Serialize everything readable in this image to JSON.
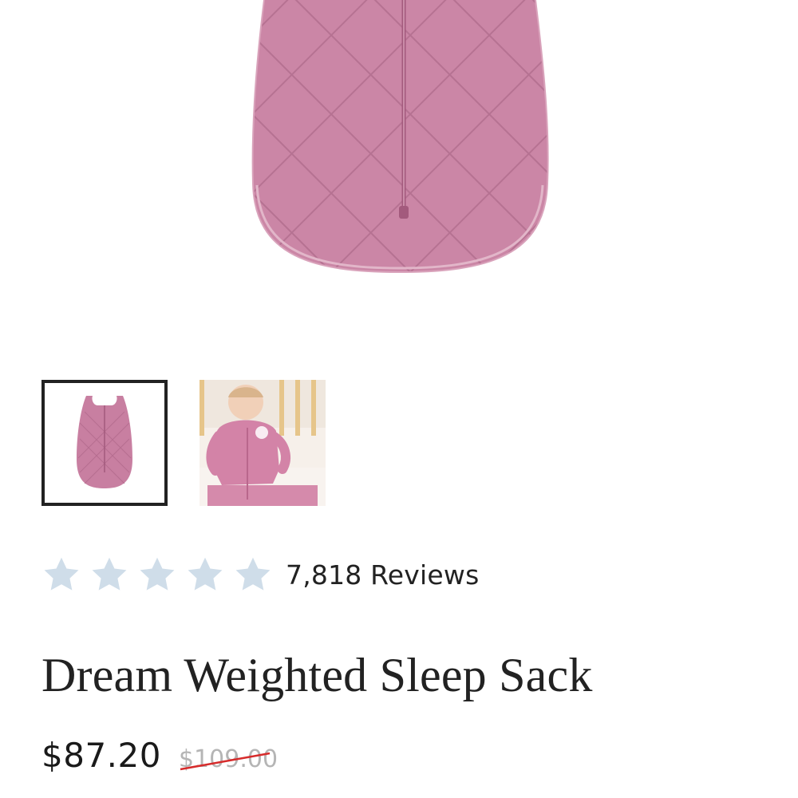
{
  "gallery": {
    "main_image": "pink-weighted-sleep-sack-product-photo",
    "thumbnails": [
      {
        "name": "sleep-sack-flat",
        "active": true
      },
      {
        "name": "baby-wearing-sleep-sack",
        "active": false
      }
    ]
  },
  "rating": {
    "stars": 5,
    "star_color": "#cfdde9",
    "reviews_label": "7,818 Reviews"
  },
  "product": {
    "title": "Dream Weighted Sleep Sack",
    "price": "$87.20",
    "compare_price": "$109.00",
    "strike_color": "#d62b2b"
  },
  "colors": {
    "product_pink": "#c77ea0",
    "text": "#222222"
  }
}
